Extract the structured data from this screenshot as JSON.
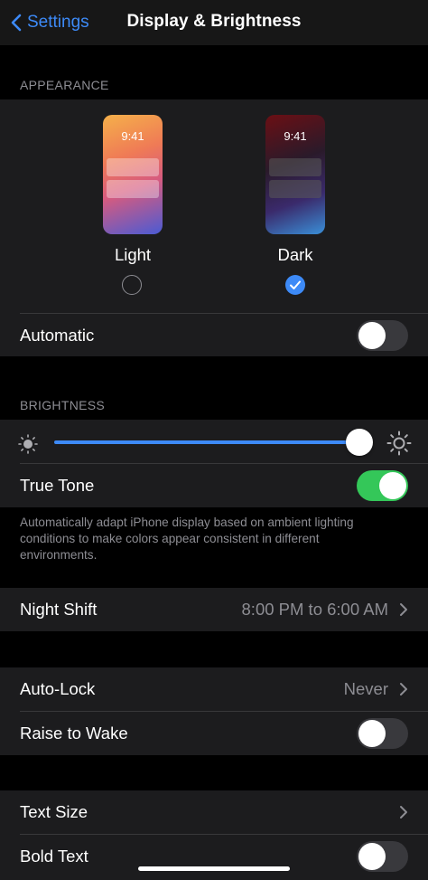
{
  "nav": {
    "back_label": "Settings",
    "title": "Display & Brightness"
  },
  "appearance": {
    "header": "APPEARANCE",
    "light": {
      "time": "9:41",
      "label": "Light",
      "selected": false
    },
    "dark": {
      "time": "9:41",
      "label": "Dark",
      "selected": true
    },
    "automatic": {
      "label": "Automatic",
      "on": false
    }
  },
  "brightness": {
    "header": "BRIGHTNESS",
    "level": 1.0,
    "true_tone": {
      "label": "True Tone",
      "on": true
    },
    "footer": "Automatically adapt iPhone display based on ambient lighting conditions to make colors appear consistent in different environments."
  },
  "night_shift": {
    "label": "Night Shift",
    "value": "8:00 PM to 6:00 AM"
  },
  "auto_lock": {
    "label": "Auto-Lock",
    "value": "Never"
  },
  "raise_to_wake": {
    "label": "Raise to Wake",
    "on": false
  },
  "text_size": {
    "label": "Text Size"
  },
  "bold_text": {
    "label": "Bold Text",
    "on": false
  },
  "colors": {
    "accent": "#3d8af7",
    "toggle_on": "#34c759",
    "group_bg": "#1c1c1e"
  },
  "icons": [
    "chevron-left-icon",
    "chevron-right-icon",
    "sun-small-icon",
    "sun-large-icon",
    "checkmark-icon"
  ]
}
